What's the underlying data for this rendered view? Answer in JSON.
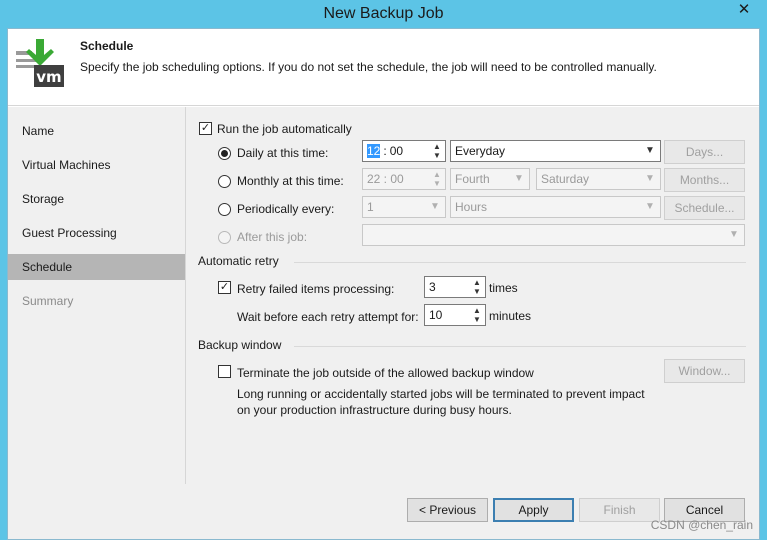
{
  "window": {
    "title": "New Backup Job",
    "close_glyph": "✕"
  },
  "header": {
    "title": "Schedule",
    "description": "Specify the job scheduling options. If you do not set the schedule, the job will need to be controlled manually.",
    "icon": "veeam-vm-download-icon",
    "icon_text": "vm",
    "icon_colors": {
      "arrow": "#3aa935",
      "box": "#3f3f3f"
    }
  },
  "sidebar": {
    "items": [
      {
        "label": "Name",
        "state": "normal"
      },
      {
        "label": "Virtual Machines",
        "state": "normal"
      },
      {
        "label": "Storage",
        "state": "normal"
      },
      {
        "label": "Guest Processing",
        "state": "normal"
      },
      {
        "label": "Schedule",
        "state": "active"
      },
      {
        "label": "Summary",
        "state": "disabled"
      }
    ]
  },
  "schedule": {
    "run_automatically": {
      "label": "Run the job automatically",
      "checked": true
    },
    "daily": {
      "label": "Daily at this time:",
      "selected": true,
      "time_hour": "12",
      "time_minute": "00",
      "time_separator": ":",
      "frequency": "Everyday",
      "button": "Days..."
    },
    "monthly": {
      "label": "Monthly at this time:",
      "selected": false,
      "time": "22 : 00",
      "week": "Fourth",
      "day": "Saturday",
      "button": "Months..."
    },
    "periodically": {
      "label": "Periodically every:",
      "selected": false,
      "value": "1",
      "unit": "Hours",
      "button": "Schedule..."
    },
    "after_job": {
      "label": "After this job:",
      "selected": false,
      "value": ""
    }
  },
  "retry": {
    "section": "Automatic retry",
    "retry_label": "Retry failed items processing:",
    "retry_checked": true,
    "retry_count": "3",
    "retry_unit": "times",
    "wait_label": "Wait before each retry attempt for:",
    "wait_value": "10",
    "wait_unit": "minutes"
  },
  "backup_window": {
    "section": "Backup window",
    "terminate_label": "Terminate the job outside of the allowed backup window",
    "terminate_checked": false,
    "note_line1": "Long running or accidentally started jobs will be terminated to prevent impact",
    "note_line2": "on your production infrastructure during busy hours.",
    "button": "Window..."
  },
  "footer": {
    "previous": "< Previous",
    "apply": "Apply",
    "finish": "Finish",
    "cancel": "Cancel"
  },
  "watermark": "CSDN @chen_rain"
}
